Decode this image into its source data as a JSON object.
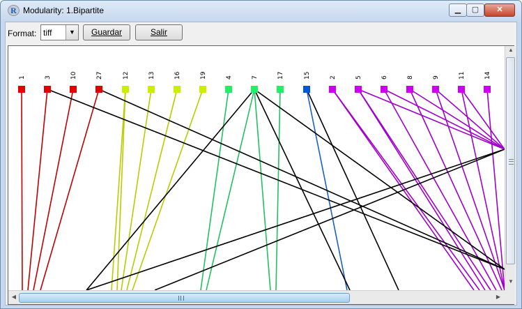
{
  "window": {
    "title": "Modularity: 1.Bipartite",
    "app_icon_letter": "R",
    "controls": {
      "minimize": "▁",
      "maximize": "▢",
      "close": "✕"
    }
  },
  "toolbar": {
    "format_label": "Format:",
    "format_value": "tiff",
    "guardar_label": "Guardar",
    "salir_label": "Salir"
  },
  "scrollbars": {
    "arrow_up": "▲",
    "arrow_down": "▼",
    "arrow_left": "◀",
    "arrow_right": "▶"
  },
  "chart_data": {
    "type": "bipartite-network",
    "top_nodes": [
      {
        "label": "1",
        "color": "#e00000"
      },
      {
        "label": "3",
        "color": "#e00000"
      },
      {
        "label": "10",
        "color": "#e00000"
      },
      {
        "label": "27",
        "color": "#e00000"
      },
      {
        "label": "12",
        "color": "#ccee00"
      },
      {
        "label": "13",
        "color": "#ccee00"
      },
      {
        "label": "16",
        "color": "#ccee00"
      },
      {
        "label": "19",
        "color": "#ccee00"
      },
      {
        "label": "4",
        "color": "#22ee66"
      },
      {
        "label": "7",
        "color": "#22ee66"
      },
      {
        "label": "17",
        "color": "#22ee66"
      },
      {
        "label": "15",
        "color": "#0055dd"
      },
      {
        "label": "2",
        "color": "#cc00ee"
      },
      {
        "label": "5",
        "color": "#cc00ee"
      },
      {
        "label": "6",
        "color": "#cc00ee"
      },
      {
        "label": "8",
        "color": "#cc00ee"
      },
      {
        "label": "9",
        "color": "#cc00ee"
      },
      {
        "label": "11",
        "color": "#cc00ee"
      },
      {
        "label": "14",
        "color": "#cc00ee"
      }
    ],
    "module_colors": {
      "red": "#c00000",
      "yellow_green": "#b8cc00",
      "green": "#22c060",
      "blue": "#1a5fc8",
      "purple": "#a000cc",
      "between_modules": "#000000"
    }
  }
}
